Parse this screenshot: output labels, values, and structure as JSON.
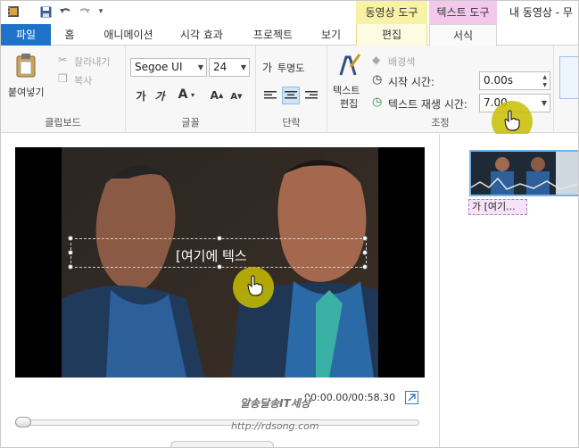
{
  "titlebar": {
    "context_video_tools": "동영상 도구",
    "context_text_tools": "텍스트 도구",
    "app_title": "내 동영상 - 무",
    "qat": [
      "film-icon",
      "save-icon",
      "undo-icon",
      "redo-icon",
      "dropdown-icon"
    ]
  },
  "tabs": {
    "file": "파일",
    "home": "홈",
    "animation": "애니메이션",
    "visual_effects": "시각 효과",
    "project": "프로젝트",
    "view": "보기",
    "edit": "편집",
    "format": "서식"
  },
  "ribbon": {
    "clipboard": {
      "paste": "붙여넣기",
      "cut": "잘라내기",
      "copy": "복사",
      "label": "클립보드"
    },
    "font": {
      "family": "Segoe UI",
      "size": "24",
      "label": "글꼴"
    },
    "paragraph": {
      "transparency": "투명도",
      "label": "단락"
    },
    "adjust": {
      "text_edit_line1": "텍스트",
      "text_edit_line2": "편집",
      "background_color": "배경색",
      "start_time_label": "시작 시간:",
      "start_time_value": "0.00s",
      "duration_label": "텍스트 재생 시간:",
      "duration_value": "7.00",
      "label": "조정"
    }
  },
  "preview": {
    "caption": "[여기에 텍스",
    "time": "00:00.00/00:58.30",
    "seek_position": 0.0
  },
  "storyboard": {
    "clip_caption": "가 [여기..."
  },
  "watermark": {
    "line1": "알송달송IT세상",
    "line2": "http://rdsong.com"
  },
  "colors": {
    "file_tab": "#1e73c8",
    "video_tools": "#f7f2a6",
    "text_tools": "#f2c9ec",
    "cursor_halo": "#c8be00"
  }
}
